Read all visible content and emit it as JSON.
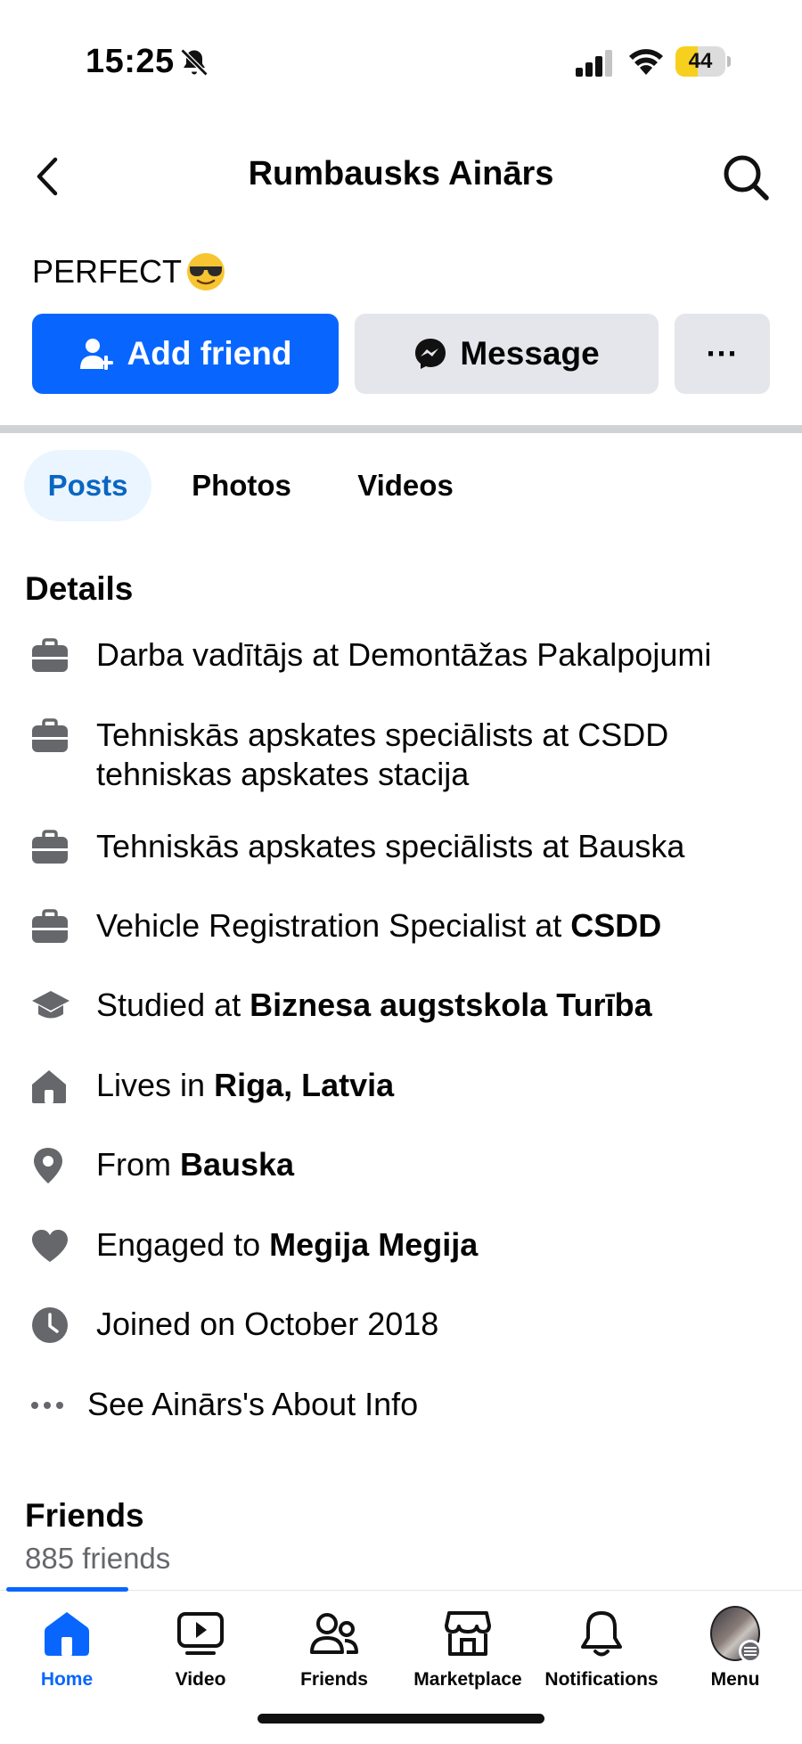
{
  "status_bar": {
    "time": "15:25",
    "battery": "44",
    "battery_level": 0.44
  },
  "header": {
    "title": "Rumbausks Ainārs"
  },
  "bio": {
    "text": "PERFECT"
  },
  "actions": {
    "add_friend": "Add friend",
    "message": "Message",
    "more": "···"
  },
  "tabs": [
    {
      "label": "Posts",
      "active": true
    },
    {
      "label": "Photos",
      "active": false
    },
    {
      "label": "Videos",
      "active": false
    }
  ],
  "details": {
    "title": "Details",
    "items": [
      {
        "icon": "briefcase-icon",
        "prefix": "Darba vadītājs at Demontāžas Pakalpojumi",
        "bold": ""
      },
      {
        "icon": "briefcase-icon",
        "prefix": "Tehniskās apskates speciālists at CSDD tehniskas apskates stacija",
        "bold": ""
      },
      {
        "icon": "briefcase-icon",
        "prefix": "Tehniskās apskates speciālists at Bauska",
        "bold": ""
      },
      {
        "icon": "briefcase-icon",
        "prefix": "Vehicle Registration Specialist at ",
        "bold": "CSDD"
      },
      {
        "icon": "graduation-cap-icon",
        "prefix": "Studied at ",
        "bold": "Biznesa augstskola Turība"
      },
      {
        "icon": "home-icon",
        "prefix": "Lives in ",
        "bold": "Riga, Latvia"
      },
      {
        "icon": "location-pin-icon",
        "prefix": "From ",
        "bold": "Bauska"
      },
      {
        "icon": "heart-icon",
        "prefix": "Engaged to ",
        "bold": "Megija Megija"
      },
      {
        "icon": "clock-icon",
        "prefix": "Joined on October 2018",
        "bold": ""
      }
    ],
    "see_about": "See Ainārs's About Info"
  },
  "friends": {
    "title": "Friends",
    "count": "885 friends"
  },
  "nav": {
    "home": "Home",
    "video": "Video",
    "friends": "Friends",
    "marketplace": "Marketplace",
    "notifications": "Notifications",
    "menu": "Menu"
  },
  "colors": {
    "accent": "#0866ff",
    "button_gray": "#e4e6eb",
    "tab_active_bg": "#ebf5ff",
    "icon_gray": "#65676b"
  }
}
